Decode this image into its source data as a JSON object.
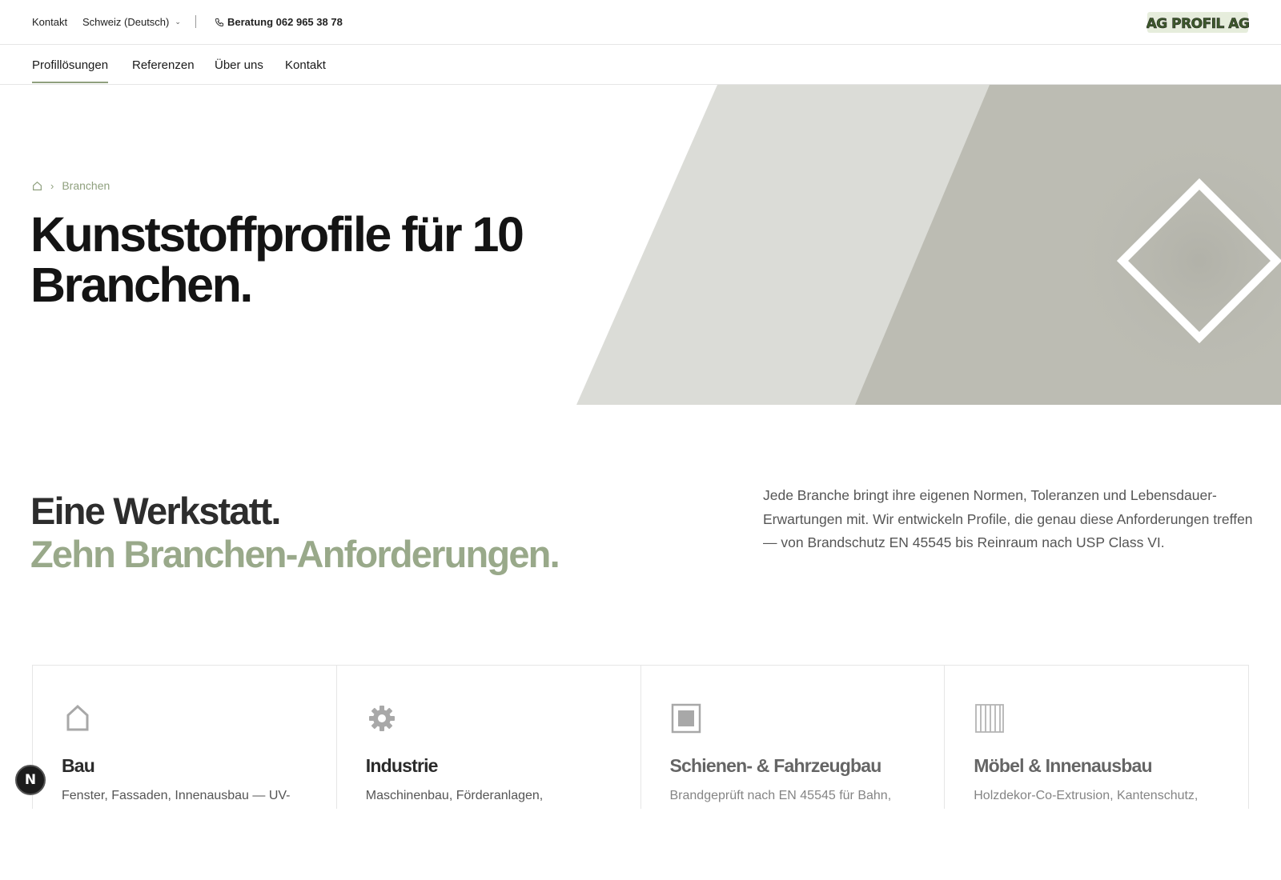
{
  "topbar": {
    "kontakt": "Kontakt",
    "language": "Schweiz (Deutsch)",
    "phone": "Beratung 062 965 38 78",
    "logo_text": "AG PROFIL AG"
  },
  "nav": {
    "items": [
      {
        "label": "Profillösungen",
        "active": true
      },
      {
        "label": "Referenzen"
      },
      {
        "label": "Über uns"
      },
      {
        "label": "Kontakt"
      }
    ]
  },
  "hero": {
    "breadcrumb": "Branchen",
    "title": "Kunststoffprofile für 10 Branchen."
  },
  "intro": {
    "title_line1": "Eine Werkstatt.",
    "title_line2": "Zehn Branchen-Anforderungen.",
    "text": "Jede Branche bringt ihre eigenen Normen, Toleranzen und Lebensdauer- Erwartungen mit. Wir entwickeln Profile, die genau diese Anforderungen treffen — von Brandschutz EN 45545 bis Reinraum nach USP Class VI."
  },
  "cards": [
    {
      "title": "Bau",
      "desc": "Fenster, Fassaden, Innenausbau — UV-",
      "icon": "house-icon"
    },
    {
      "title": "Industrie",
      "desc": "Maschinenbau, Förderanlagen,",
      "icon": "gear-icon"
    },
    {
      "title": "Schienen- & Fahrzeugbau",
      "desc": "Brandgeprüft nach EN 45545 für Bahn,",
      "icon": "square-frame-icon"
    },
    {
      "title": "Möbel & Innenausbau",
      "desc": "Holzdekor-Co-Extrusion, Kantenschutz,",
      "icon": "grid-icon"
    }
  ],
  "colors": {
    "accent": "#8fa07e",
    "hero_light": "#dbdcd7",
    "hero_dark": "#bcbcb3"
  },
  "badge": "N"
}
